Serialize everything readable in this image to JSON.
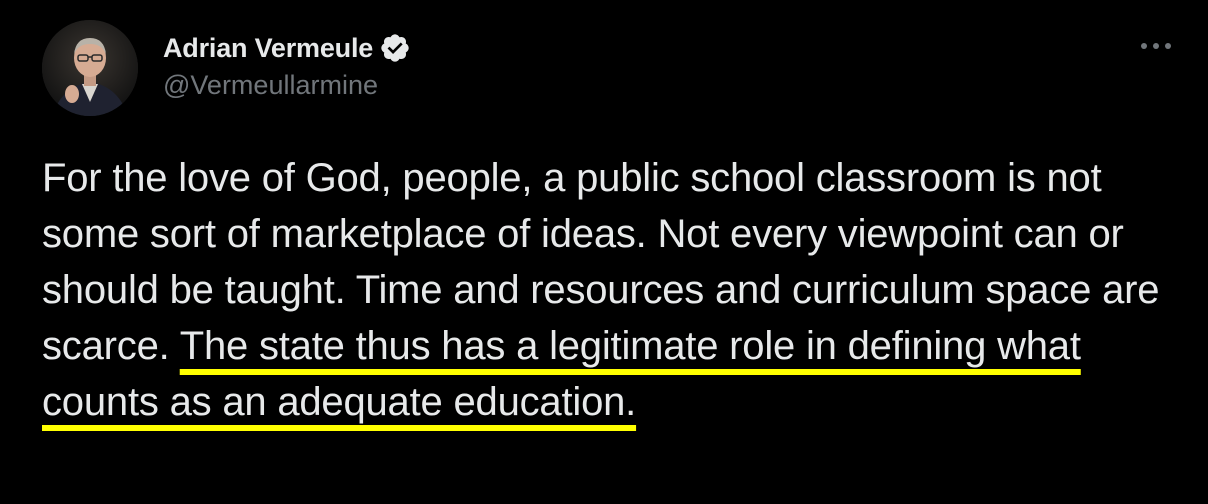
{
  "author": {
    "display_name": "Adrian Vermeule",
    "handle": "@Vermeullarmine",
    "verified": true,
    "avatar_icon": "profile-photo"
  },
  "more_icon": "ellipsis-horizontal-icon",
  "tweet": {
    "text_plain": "For the love of God, people, a public school classroom is not some sort of marketplace of ideas. Not every viewpoint can or should be taught. Time and resources and curriculum space are scarce. ",
    "text_highlighted": "The state thus has a legitimate role in defining what counts as an adequate education."
  },
  "colors": {
    "background": "#000000",
    "text": "#e7e9ea",
    "handle": "#71767b",
    "verified_badge": "#e7e9ea",
    "highlight_underline": "#ffff00"
  }
}
